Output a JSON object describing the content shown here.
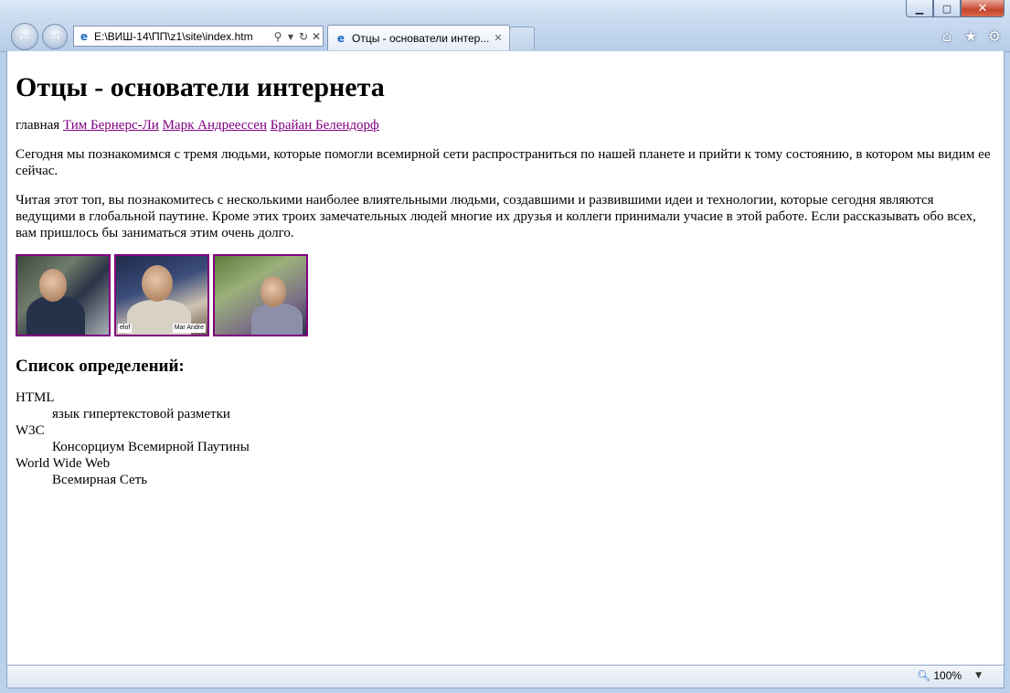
{
  "browser": {
    "address_url": "E:\\ВИШ-14\\ПП\\z1\\site\\index.htm",
    "tab_title": "Отцы - основатели интер...",
    "zoom_level": "100%",
    "window_buttons": {
      "minimize_icon": "minimize-icon",
      "maximize_icon": "maximize-icon",
      "close_icon": "close-icon"
    },
    "toolbar_icons": [
      "home-icon",
      "favorites-star-icon",
      "settings-gear-icon"
    ]
  },
  "page": {
    "heading": "Отцы - основатели интернета",
    "nav": {
      "current": "главная",
      "links": [
        "Тим Бернерс-Ли",
        "Марк Андреессен",
        "Брайан Белендорф"
      ]
    },
    "paragraphs": [
      "Сегодня мы познакомимся с тремя людьми, которые помогли всемирной сети распространиться по нашей планете и прийти к тому состоянию, в котором мы видим ее сейчас.",
      "Читая этот топ, вы познакомитесь с несколькими наиболее влиятельными людьми, создавшими и развившими идеи и технологии, которые сегодня являются ведущими в глобальной паутине. Кроме этих троих замечательных людей многие их друзья и коллеги принимали учасие в этой работе. Если рассказывать обо всех, вам пришлось бы заниматься этим очень долго."
    ],
    "photo_caption_fragment": "Mar Andre",
    "photo_caption_fragment_left": "elof",
    "definitions_heading": "Список определений:",
    "definitions": [
      {
        "term": "HTML",
        "description": "язык гипертекстовой разметки"
      },
      {
        "term": "W3C",
        "description": "Консорциум Всемирной Паутины"
      },
      {
        "term": "World Wide Web",
        "description": "Всемирная Сеть"
      }
    ]
  },
  "colors": {
    "visited_link": "#800080",
    "photo_border": "#800080",
    "chrome_blue": "#b9d1ea"
  }
}
